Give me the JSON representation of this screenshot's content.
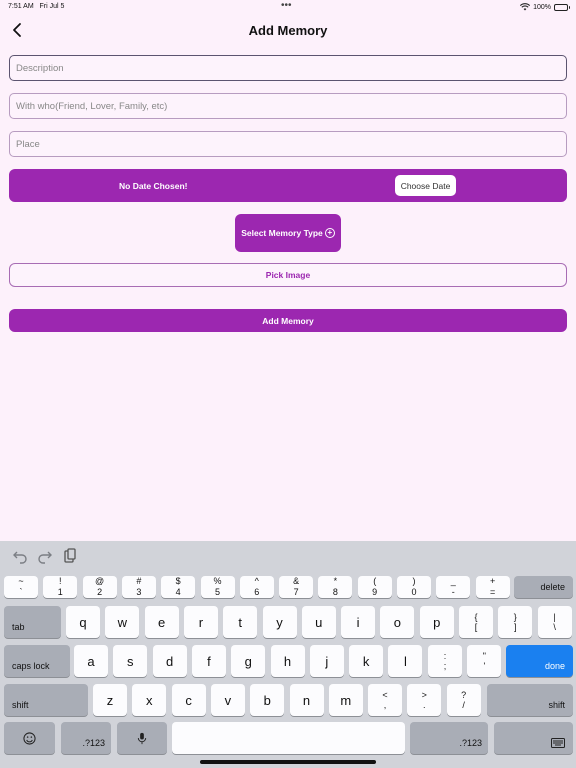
{
  "status": {
    "time": "7:51 AM",
    "date": "Fri Jul 5",
    "battery": "100%"
  },
  "nav": {
    "title": "Add Memory"
  },
  "form": {
    "description_placeholder": "Description",
    "with_who_placeholder": "With who(Friend, Lover, Family, etc)",
    "place_placeholder": "Place",
    "date_status": "No Date Chosen!",
    "choose_date_label": "Choose Date",
    "memory_type_label": "Select Memory Type",
    "pick_image_label": "Pick Image",
    "add_memory_label": "Add Memory"
  },
  "keyboard": {
    "row1": [
      {
        "top": "~",
        "bottom": "`"
      },
      {
        "top": "!",
        "bottom": "1"
      },
      {
        "top": "@",
        "bottom": "2"
      },
      {
        "top": "#",
        "bottom": "3"
      },
      {
        "top": "$",
        "bottom": "4"
      },
      {
        "top": "%",
        "bottom": "5"
      },
      {
        "top": "^",
        "bottom": "6"
      },
      {
        "top": "&",
        "bottom": "7"
      },
      {
        "top": "*",
        "bottom": "8"
      },
      {
        "top": "(",
        "bottom": "9"
      },
      {
        "top": ")",
        "bottom": "0"
      },
      {
        "top": "_",
        "bottom": "-"
      },
      {
        "top": "+",
        "bottom": "="
      }
    ],
    "delete": "delete",
    "tab": "tab",
    "row2": [
      "q",
      "w",
      "e",
      "r",
      "t",
      "y",
      "u",
      "i",
      "o",
      "p"
    ],
    "row2_sym": [
      {
        "top": "{",
        "bottom": "["
      },
      {
        "top": "}",
        "bottom": "]"
      },
      {
        "top": "|",
        "bottom": "\\"
      }
    ],
    "caps": "caps lock",
    "row3": [
      "a",
      "s",
      "d",
      "f",
      "g",
      "h",
      "j",
      "k",
      "l"
    ],
    "row3_sym": [
      {
        "top": ":",
        "bottom": ";"
      },
      {
        "top": "\"",
        "bottom": "'"
      }
    ],
    "done": "done",
    "shift": "shift",
    "row4": [
      "z",
      "x",
      "c",
      "v",
      "b",
      "n",
      "m"
    ],
    "row4_sym": [
      {
        "top": "<",
        "bottom": ","
      },
      {
        "top": ">",
        "bottom": "."
      },
      {
        "top": "?",
        "bottom": "/"
      }
    ],
    "numbers": ".?123"
  }
}
